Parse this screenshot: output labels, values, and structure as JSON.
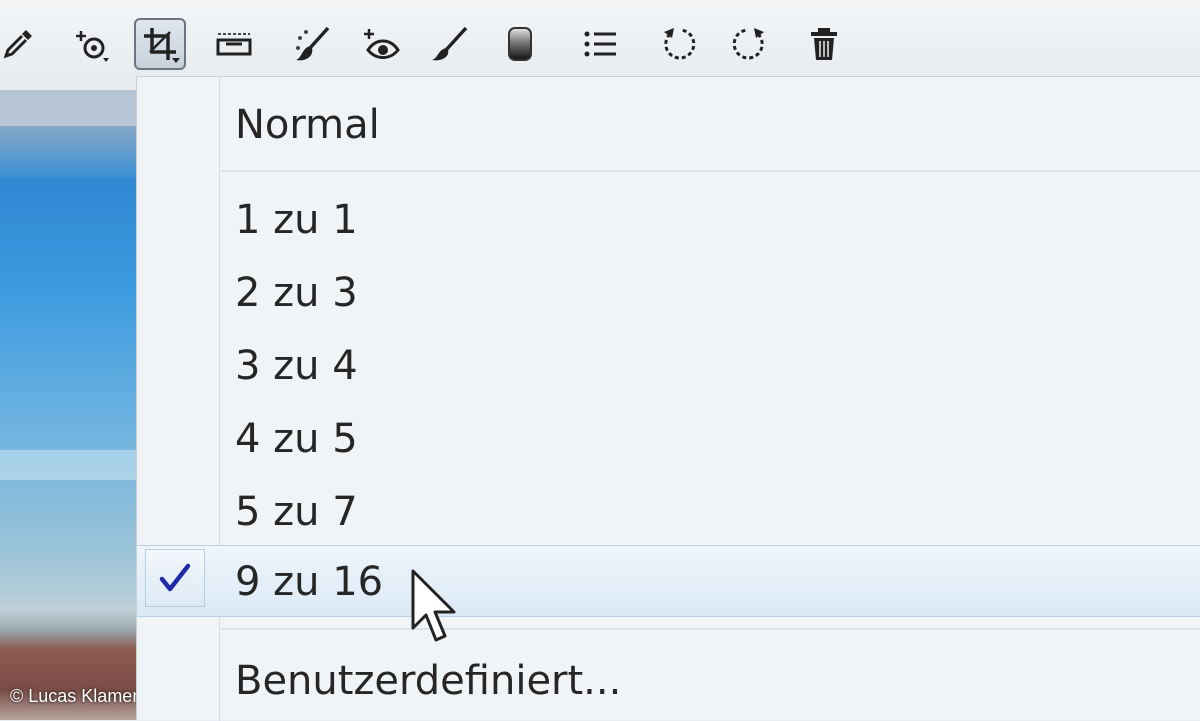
{
  "toolbar": {
    "tools": [
      {
        "icon": "eyedropper-icon"
      },
      {
        "icon": "add-point-icon"
      },
      {
        "icon": "crop-icon",
        "active": true
      },
      {
        "icon": "straighten-icon"
      },
      {
        "icon": "retouch-brush-icon"
      },
      {
        "icon": "red-eye-icon"
      },
      {
        "icon": "brush-icon"
      },
      {
        "icon": "gradient-icon"
      },
      {
        "icon": "list-icon"
      },
      {
        "icon": "rotate-left-icon"
      },
      {
        "icon": "rotate-right-icon"
      },
      {
        "icon": "trash-icon"
      }
    ]
  },
  "menu": {
    "items": [
      {
        "label": "Normal"
      },
      {
        "label": "1 zu 1"
      },
      {
        "label": "2 zu 3"
      },
      {
        "label": "3 zu 4"
      },
      {
        "label": "4 zu 5"
      },
      {
        "label": "5 zu 7"
      },
      {
        "label": "9 zu 16",
        "checked": true
      },
      {
        "label": "Benutzerdefiniert..."
      }
    ]
  },
  "credit": "© Lucas Klamert",
  "colors": {
    "checkmark": "#1f2ba8",
    "menu_bg": "#f1f4f7",
    "selected_bg": "#dbe9f6"
  }
}
